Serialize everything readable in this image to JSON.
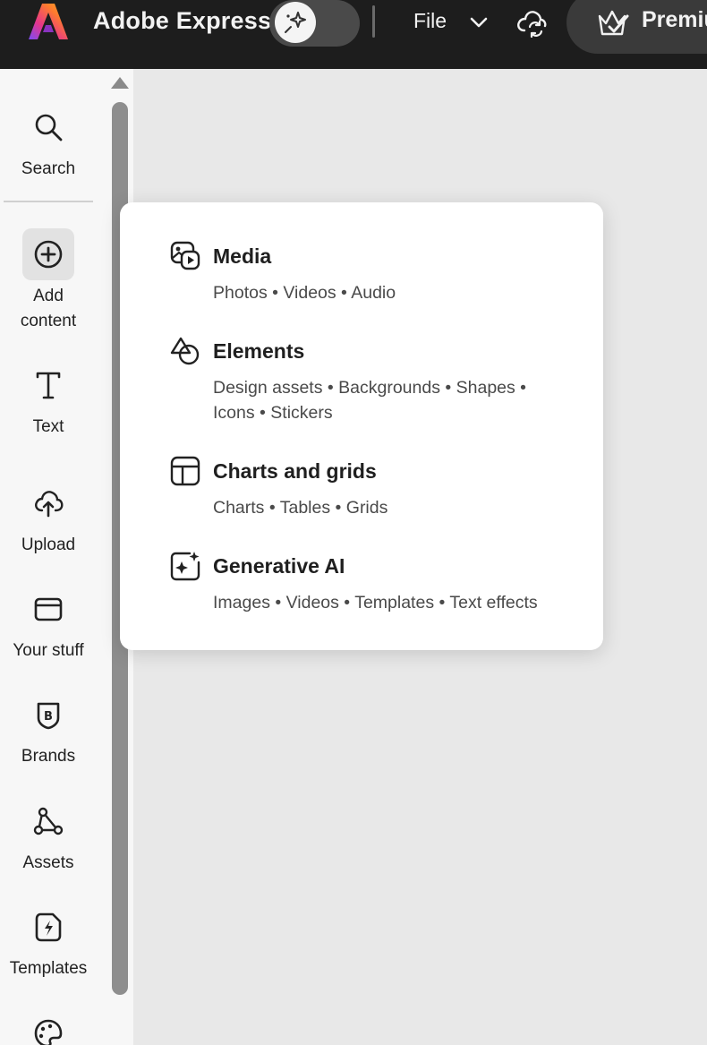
{
  "topbar": {
    "app_name": "Adobe Express",
    "file_label": "File",
    "premium_label": "Premium"
  },
  "rail": {
    "items": [
      {
        "label": "Search",
        "icon": "search-icon"
      },
      {
        "label": "Add\ncontent",
        "icon": "add-circle-icon"
      },
      {
        "label": "Text",
        "icon": "text-icon"
      },
      {
        "label": "Upload",
        "icon": "cloud-upload-icon"
      },
      {
        "label": "Your stuff",
        "icon": "folder-icon"
      },
      {
        "label": "Brands",
        "icon": "brand-shield-icon"
      },
      {
        "label": "Assets",
        "icon": "assets-nodes-icon"
      },
      {
        "label": "Templates",
        "icon": "templates-icon"
      }
    ]
  },
  "menu": {
    "items": [
      {
        "title": "Media",
        "subtitle": "Photos • Videos • Audio",
        "icon": "media-icon"
      },
      {
        "title": "Elements",
        "subtitle": "Design assets • Backgrounds • Shapes • Icons • Stickers",
        "icon": "elements-shapes-icon"
      },
      {
        "title": "Charts and grids",
        "subtitle": "Charts • Tables • Grids",
        "icon": "grid-layout-icon"
      },
      {
        "title": "Generative AI",
        "subtitle": "Images • Videos • Templates • Text effects",
        "icon": "sparkle-icon"
      }
    ]
  },
  "colors": {
    "topbar_bg": "#1d1d1d",
    "rail_bg": "#f7f7f7",
    "canvas_bg": "#e8e8e8",
    "popover_bg": "#ffffff"
  }
}
